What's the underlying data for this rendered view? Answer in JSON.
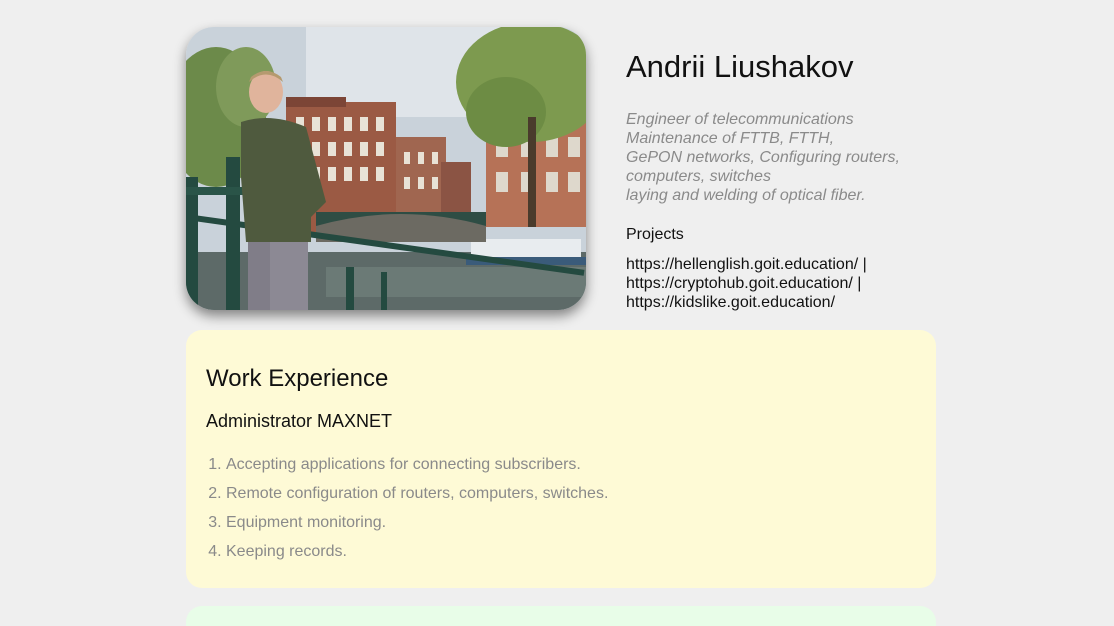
{
  "profile": {
    "name": "Andrii Liushakov",
    "tagline": [
      "Engineer of telecommunications",
      "Maintenance of FTTB, FTTH,",
      "GePON networks, Configuring routers,",
      "computers, switches",
      "laying and welding of optical fiber."
    ],
    "projects_title": "Projects",
    "projects": [
      "https://hellenglish.goit.education/ |",
      "https://cryptohub.goit.education/ |",
      "https://kidslike.goit.education/"
    ]
  },
  "work": {
    "title": "Work Experience",
    "position": "Administrator MAXNET",
    "duties": [
      "Accepting applications for connecting subscribers.",
      "Remote configuration of routers, computers, switches.",
      "Equipment monitoring.",
      "Keeping records."
    ]
  },
  "colors": {
    "background": "#efefef",
    "work_card": "#fefad6",
    "next_card": "#e8fde8",
    "muted_text": "#8a8a8a"
  }
}
